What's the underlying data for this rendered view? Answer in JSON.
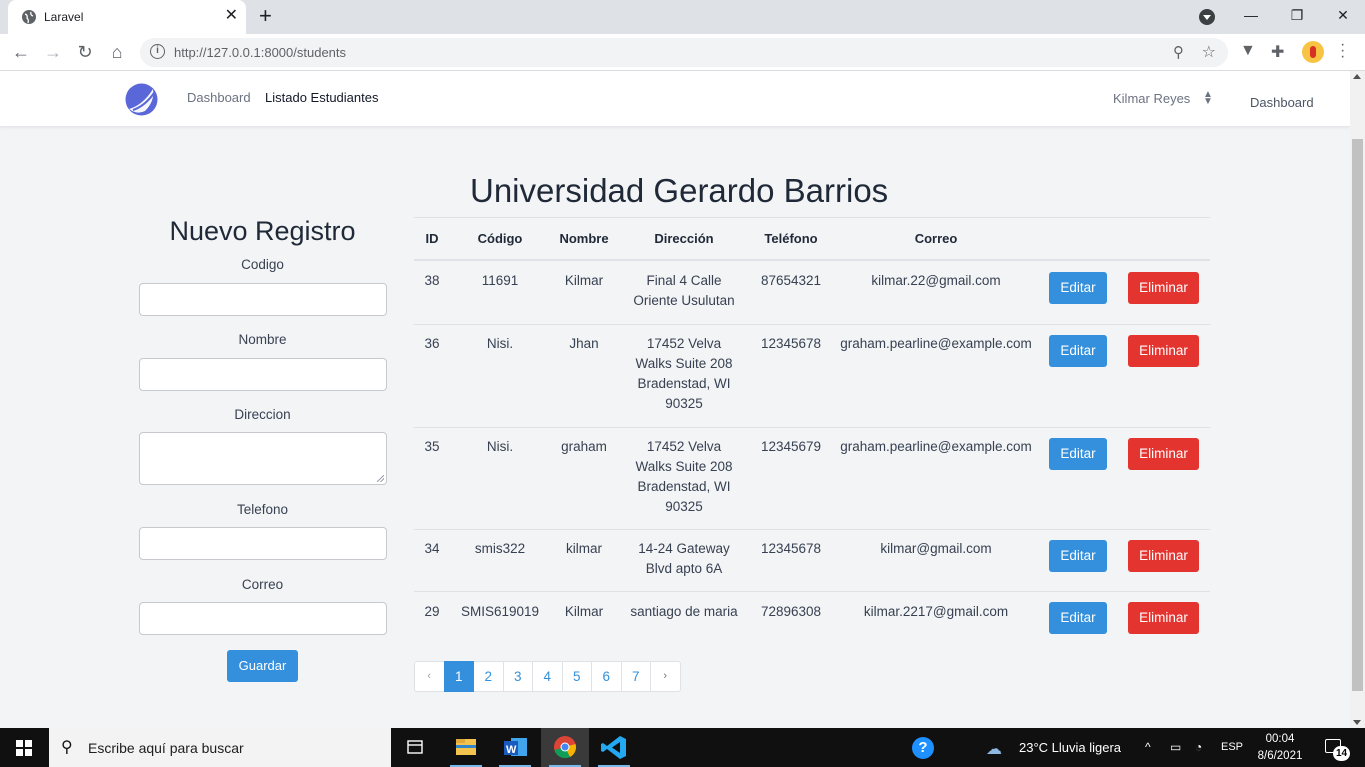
{
  "browser": {
    "tab_title": "Laravel",
    "tab_close": "✕",
    "new_tab": "+",
    "url": "http://127.0.0.1:8000/students",
    "window_controls": [
      "—",
      "❐",
      "✕"
    ]
  },
  "app": {
    "nav": {
      "links": [
        "Dashboard",
        "Listado Estudiantes"
      ],
      "user": "Kilmar Reyes",
      "right_link": "Dashboard"
    },
    "university": "Universidad Gerardo Barrios",
    "form": {
      "title": "Nuevo Registro",
      "labels": {
        "codigo": "Codigo",
        "nombre": "Nombre",
        "direccion": "Direccion",
        "telefono": "Telefono",
        "correo": "Correo"
      },
      "submit": "Guardar"
    },
    "table": {
      "headers": [
        "ID",
        "Código",
        "Nombre",
        "Dirección",
        "Teléfono",
        "Correo"
      ],
      "rows": [
        {
          "id": "38",
          "codigo": "11691",
          "nombre": "Kilmar",
          "direccion": [
            "Final 4 Calle",
            "Oriente Usulutan"
          ],
          "telefono": "87654321",
          "correo": "kilmar.22@gmail.com"
        },
        {
          "id": "36",
          "codigo": "Nisi.",
          "nombre": "Jhan",
          "direccion": [
            "17452 Velva",
            "Walks Suite 208",
            "Bradenstad, WI",
            "90325"
          ],
          "telefono": "12345678",
          "correo": "graham.pearline@example.com"
        },
        {
          "id": "35",
          "codigo": "Nisi.",
          "nombre": "graham",
          "direccion": [
            "17452 Velva",
            "Walks Suite 208",
            "Bradenstad, WI",
            "90325"
          ],
          "telefono": "12345679",
          "correo": "graham.pearline@example.com"
        },
        {
          "id": "34",
          "codigo": "smis322",
          "nombre": "kilmar",
          "direccion": [
            "14-24 Gateway",
            "Blvd apto 6A"
          ],
          "telefono": "12345678",
          "correo": "kilmar@gmail.com"
        },
        {
          "id": "29",
          "codigo": "SMIS619019",
          "nombre": "Kilmar",
          "direccion": [
            "santiago de maria"
          ],
          "telefono": "72896308",
          "correo": "kilmar.2217@gmail.com"
        }
      ],
      "edit_label": "Editar",
      "delete_label": "Eliminar"
    },
    "pagination": {
      "prev": "‹",
      "pages": [
        "1",
        "2",
        "3",
        "4",
        "5",
        "6",
        "7"
      ],
      "current": "1",
      "next": "›"
    }
  },
  "taskbar": {
    "search_placeholder": "Escribe aquí para buscar",
    "weather": "23°C  Lluvia ligera",
    "language": "ESP",
    "time": "00:04",
    "date": "8/6/2021",
    "notifications": "14"
  },
  "colors": {
    "primary": "#3490dc",
    "danger": "#e3342f",
    "page_bg": "#f3f4f6"
  }
}
